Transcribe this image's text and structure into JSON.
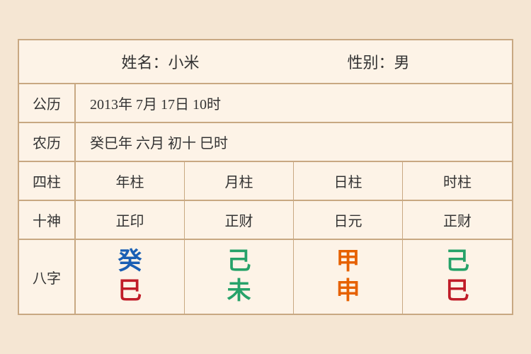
{
  "header": {
    "name_label": "姓名：小米",
    "gender_label": "性别：男"
  },
  "solar": {
    "label": "公历",
    "value": "2013年 7月 17日 10时"
  },
  "lunar": {
    "label": "农历",
    "value": "癸巳年 六月 初十 巳时"
  },
  "pillars": {
    "label": "四柱",
    "columns": [
      "年柱",
      "月柱",
      "日柱",
      "时柱"
    ]
  },
  "shishen": {
    "label": "十神",
    "columns": [
      "正印",
      "正财",
      "日元",
      "正财"
    ]
  },
  "bazhi": {
    "label": "八字",
    "columns": [
      {
        "top": "癸",
        "top_color": "color-blue",
        "bottom": "巳",
        "bottom_color": "color-red"
      },
      {
        "top": "己",
        "top_color": "color-green",
        "bottom": "未",
        "bottom_color": "color-green"
      },
      {
        "top": "甲",
        "top_color": "color-orange",
        "bottom": "申",
        "bottom_color": "color-orange"
      },
      {
        "top": "己",
        "top_color": "color-green2",
        "bottom": "巳",
        "bottom_color": "color-red"
      }
    ]
  }
}
